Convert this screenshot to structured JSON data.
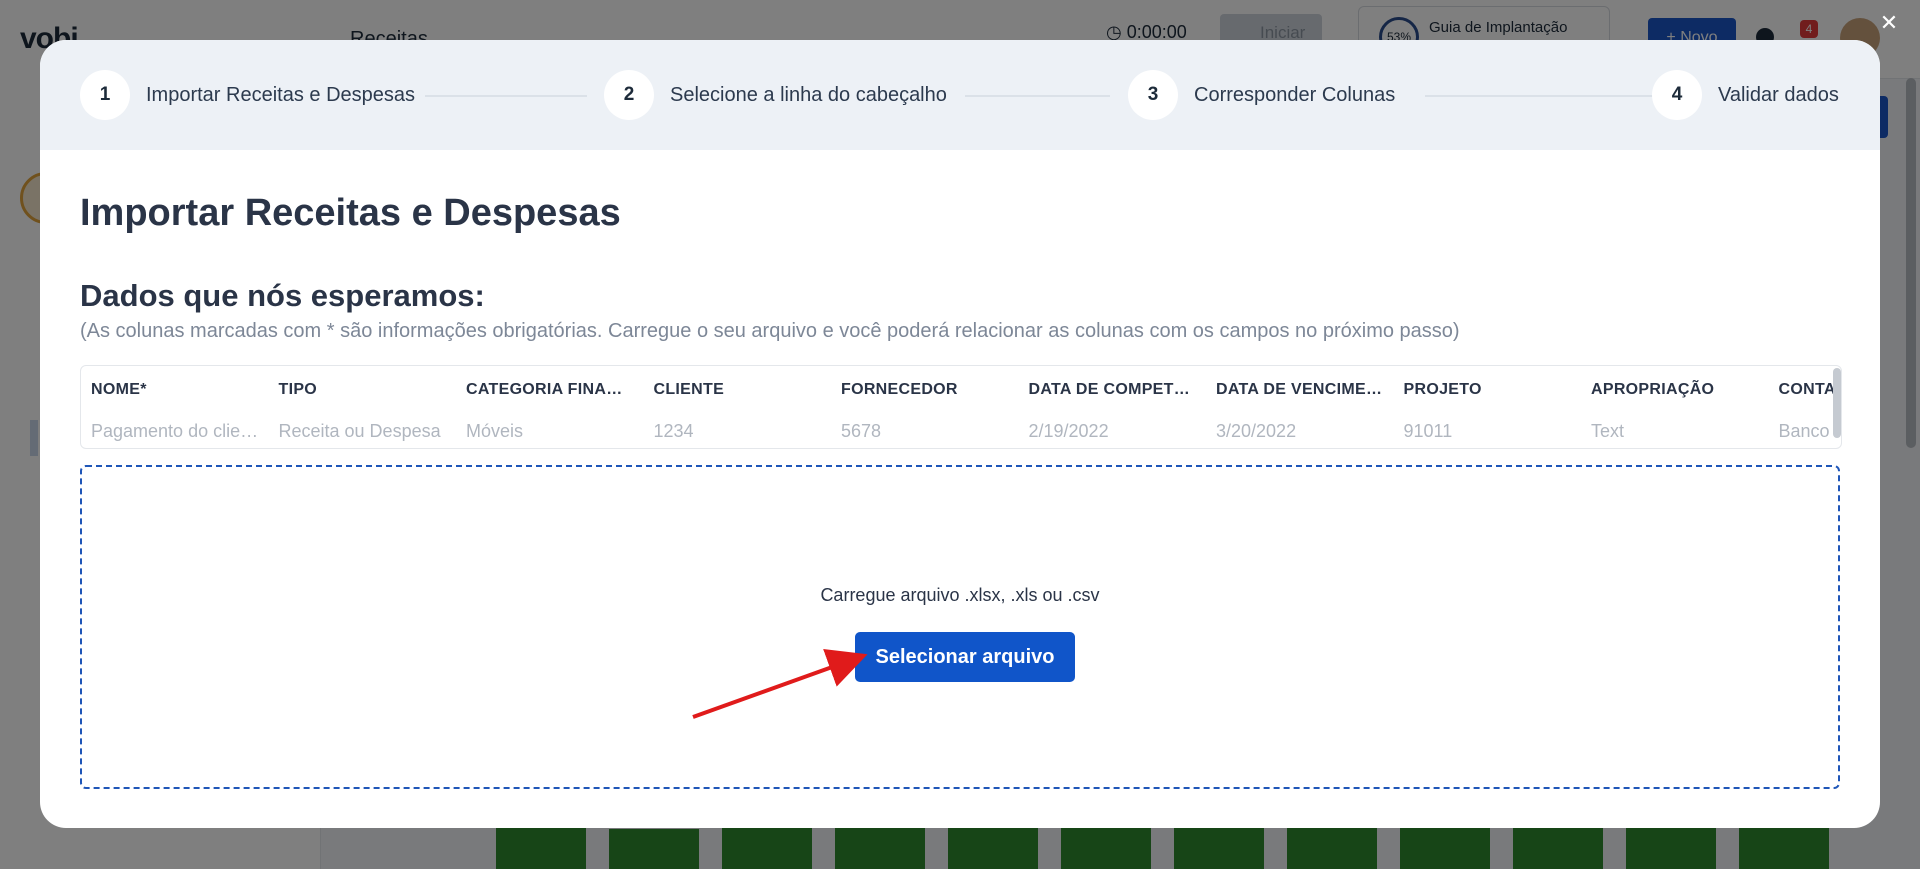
{
  "background": {
    "logo": "vobi",
    "page_title": "Receitas",
    "timer": "0:00:00",
    "start_button": "Iniciar",
    "guide": {
      "percent": "53%",
      "label": "Guia de Implantação"
    },
    "new_button": "Novo",
    "notifications_count": "4"
  },
  "modal": {
    "close_label": "✕",
    "steps": [
      {
        "number": "1",
        "label": "Importar Receitas e Despesas"
      },
      {
        "number": "2",
        "label": "Selecione a linha do cabeçalho"
      },
      {
        "number": "3",
        "label": "Corresponder Colunas"
      },
      {
        "number": "4",
        "label": "Validar dados"
      }
    ],
    "title": "Importar Receitas e Despesas",
    "expected_heading": "Dados que nós esperamos:",
    "expected_note": "(As colunas marcadas com * são informações obrigatórias. Carregue o seu arquivo e você poderá relacionar as colunas com os campos no próximo passo)",
    "table": {
      "headers": [
        "NOME*",
        "TIPO",
        "CATEGORIA FINANCEIRA",
        "CLIENTE",
        "FORNECEDOR",
        "DATA DE COMPETÊNCIA",
        "DATA DE VENCIMENTO",
        "PROJETO",
        "APROPRIAÇÃO",
        "CONTA"
      ],
      "example_row": [
        "Pagamento do cliente",
        "Receita ou Despesa",
        "Móveis",
        "1234",
        "5678",
        "2/19/2022",
        "3/20/2022",
        "91011",
        "Text",
        "Banco"
      ]
    },
    "dropzone": {
      "instruction": "Carregue arquivo .xlsx, .xls ou .csv",
      "button": "Selecionar arquivo"
    }
  }
}
